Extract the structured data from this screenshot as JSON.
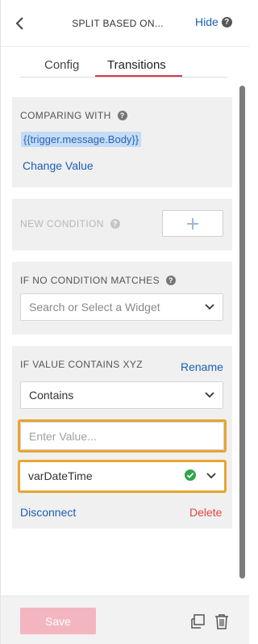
{
  "header": {
    "title": "SPLIT BASED ON...",
    "hide_label": "Hide",
    "back_icon": "chevron-left-icon",
    "help_icon": "question-circle-icon"
  },
  "tabs": [
    {
      "label": "Config",
      "active": false
    },
    {
      "label": "Transitions",
      "active": true
    }
  ],
  "comparing": {
    "label": "COMPARING WITH",
    "value": "{{trigger.message.Body}}",
    "change_label": "Change Value"
  },
  "new_condition": {
    "label": "NEW CONDITION",
    "add_icon": "plus-icon"
  },
  "no_match": {
    "label": "IF NO CONDITION MATCHES",
    "placeholder": "Search or Select a Widget"
  },
  "condition": {
    "label": "IF VALUE CONTAINS XYZ",
    "rename_label": "Rename",
    "operator": "Contains",
    "value_placeholder": "Enter Value...",
    "widget": "varDateTime",
    "disconnect_label": "Disconnect",
    "delete_label": "Delete"
  },
  "footer": {
    "save_label": "Save",
    "duplicate_icon": "duplicate-icon",
    "trash_icon": "trash-icon"
  },
  "colors": {
    "link": "#1a5fb4",
    "tab_accent": "#d9374e",
    "highlight_border": "#e8a530",
    "delete": "#e0473e",
    "save_disabled": "#f3b6c0",
    "check": "#2fa64a"
  }
}
